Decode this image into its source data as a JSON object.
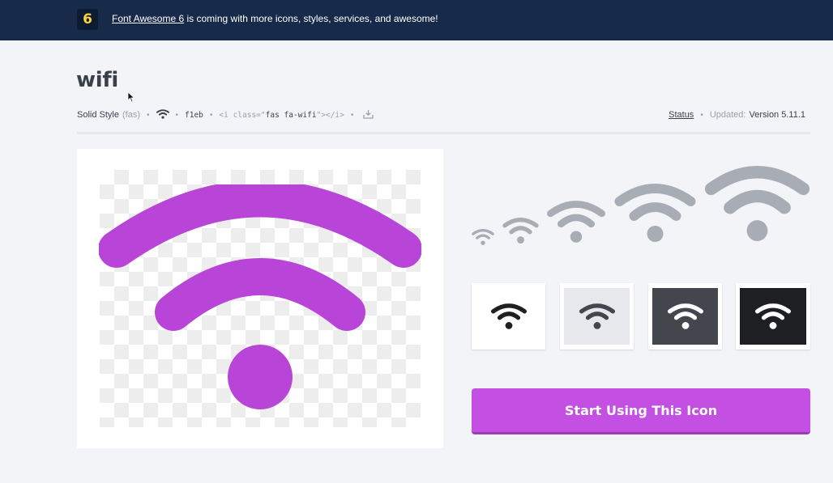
{
  "banner": {
    "badge": "6",
    "link_text": "Font Awesome 6",
    "message": " is coming with more icons, styles, services, and awesome!"
  },
  "icon": {
    "name": "wifi",
    "style_label": "Solid Style",
    "style_prefix": "(fas)",
    "unicode": "f1eb",
    "code_open": "<i class=\"",
    "code_class": "fas fa-wifi",
    "code_close": "\"></i>"
  },
  "meta": {
    "status_label": "Status",
    "updated_label": "Updated:",
    "version": "Version 5.11.1"
  },
  "colors": {
    "banner_bg": "#182a4a",
    "accent_purple": "#b845d8",
    "cta_bg": "#c350e2",
    "ramp_gray": "#a8adb5",
    "swatch_white": "#ffffff",
    "swatch_light": "#e6e8ec",
    "swatch_dark": "#43464d",
    "swatch_black": "#1e1f22"
  },
  "icons": {
    "primary": "wifi-icon",
    "download": "download-icon",
    "badge": "font-awesome-6-logo"
  },
  "swatches": [
    {
      "name": "white",
      "bg": "#ffffff",
      "fg": "#1e1f22"
    },
    {
      "name": "light",
      "bg": "#e6e8ec",
      "fg": "#43464d"
    },
    {
      "name": "dark",
      "bg": "#43464d",
      "fg": "#ffffff"
    },
    {
      "name": "black",
      "bg": "#1e1f22",
      "fg": "#ffffff"
    }
  ],
  "cta": {
    "label": "Start Using This Icon"
  }
}
